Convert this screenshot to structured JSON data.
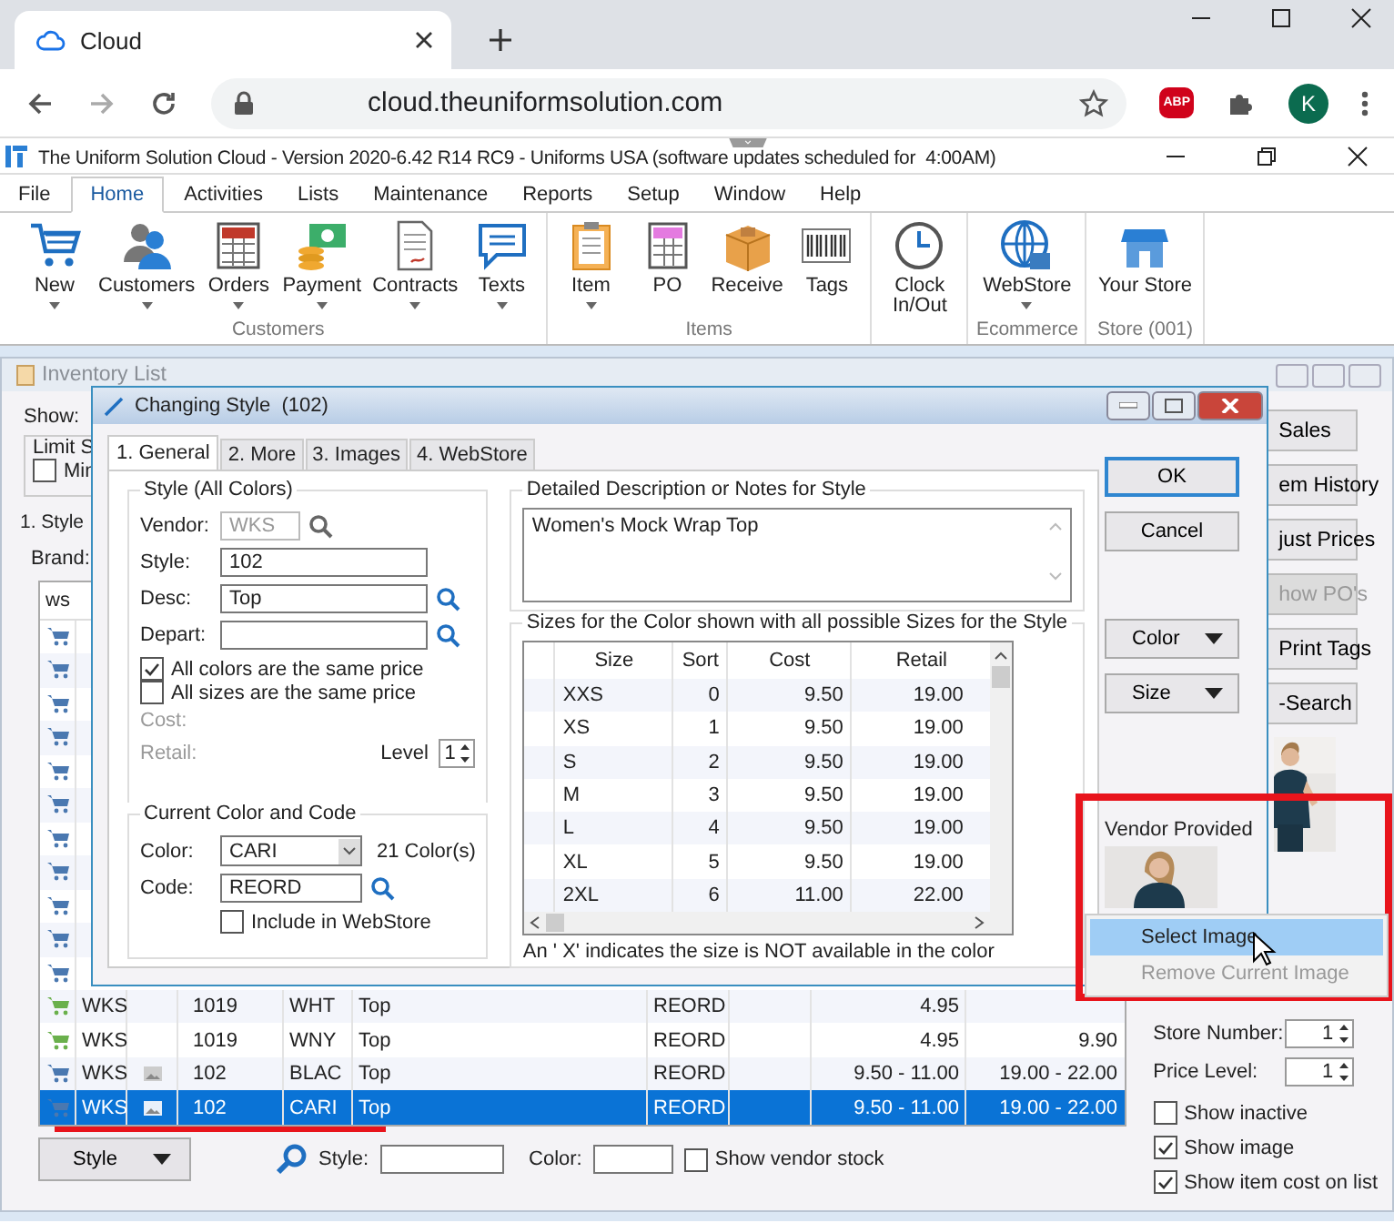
{
  "browser": {
    "tab_title": "Cloud",
    "url": "cloud.theuniformsolution.com",
    "abp": "ABP",
    "avatar": "K"
  },
  "app": {
    "title": "The Uniform Solution Cloud - Version 2020-6.42 R14 RC9 - Uniforms USA (software updates scheduled for  4:00AM)"
  },
  "menu": [
    {
      "label": "File",
      "selected": false
    },
    {
      "label": "Home",
      "selected": true
    },
    {
      "label": "Activities",
      "selected": false
    },
    {
      "label": "Lists",
      "selected": false
    },
    {
      "label": "Maintenance",
      "selected": false
    },
    {
      "label": "Reports",
      "selected": false
    },
    {
      "label": "Setup",
      "selected": false
    },
    {
      "label": "Window",
      "selected": false
    },
    {
      "label": "Help",
      "selected": false
    }
  ],
  "ribbon": [
    {
      "label": "Customers",
      "items": [
        {
          "label": "New",
          "dropdown": true
        },
        {
          "label": "Customers",
          "dropdown": true
        },
        {
          "label": "Orders",
          "dropdown": true
        },
        {
          "label": "Payment",
          "dropdown": true
        },
        {
          "label": "Contracts",
          "dropdown": true
        },
        {
          "label": "Texts",
          "dropdown": true
        }
      ]
    },
    {
      "label": "Items",
      "items": [
        {
          "label": "Item",
          "dropdown": true
        },
        {
          "label": "PO",
          "dropdown": false
        },
        {
          "label": "Receive",
          "dropdown": false
        },
        {
          "label": "Tags",
          "dropdown": false
        }
      ]
    },
    {
      "items": [
        {
          "label": "Clock In/Out",
          "dropdown": false
        }
      ]
    },
    {
      "label": "Ecommerce",
      "items": [
        {
          "label": "WebStore",
          "dropdown": true
        }
      ]
    },
    {
      "label": "Store (001)",
      "items": [
        {
          "label": "Your Store",
          "dropdown": false
        }
      ]
    }
  ],
  "inventory": {
    "title": "Inventory List",
    "show_label": "Show:",
    "limit_label": "Limit S",
    "min_checkbox": {
      "label": "Min",
      "checked": false
    },
    "tab": "1. Style",
    "brand_label": "Brand:",
    "header": "ws",
    "rows": [
      {
        "color": "#4a78b0",
        "selected": false
      },
      {
        "color": "#4a78b0",
        "selected": false
      },
      {
        "color": "#4a78b0",
        "selected": false
      },
      {
        "color": "#4a78b0",
        "selected": false
      },
      {
        "color": "#4a78b0",
        "selected": false
      },
      {
        "color": "#4a78b0",
        "selected": false
      },
      {
        "color": "#4a78b0",
        "selected": false
      },
      {
        "color": "#4a78b0",
        "selected": false
      },
      {
        "color": "#4a78b0",
        "selected": false
      },
      {
        "color": "#4a78b0",
        "selected": false
      },
      {
        "color": "#4a78b0",
        "selected": false
      },
      {
        "color": "#6ab04c",
        "vendor": "WKS",
        "image": false,
        "style": "1019",
        "color_code": "WHT",
        "desc": "Top",
        "code": "REORD",
        "cost": "4.95",
        "selected": false
      },
      {
        "color": "#6ab04c",
        "vendor": "WKS",
        "image": false,
        "style": "1019",
        "color_code": "WNY",
        "desc": "Top",
        "code": "REORD",
        "cost": "4.95",
        "retail": "9.90",
        "selected": false
      },
      {
        "color": "#4a78b0",
        "vendor": "WKS",
        "image": true,
        "style": "102",
        "color_code": "BLAC",
        "desc": "Top",
        "code": "REORD",
        "cost": "9.50 - 11.00",
        "retail": "19.00 - 22.00",
        "selected": false
      },
      {
        "color": "#4a78b0",
        "vendor": "WKS",
        "image": true,
        "style": "102",
        "color_code": "CARI",
        "desc": "Top",
        "code": "REORD",
        "cost": "9.50 - 11.00",
        "retail": "19.00 - 22.00",
        "selected": true
      }
    ],
    "side_buttons": [
      {
        "label": "Sales",
        "disabled": false
      },
      {
        "label": "em History",
        "disabled": false
      },
      {
        "label": "just Prices",
        "disabled": false
      },
      {
        "label": "how PO's",
        "disabled": true
      },
      {
        "label": "Print Tags",
        "disabled": false
      },
      {
        "label": "-Search",
        "disabled": false
      }
    ],
    "store_number": {
      "label": "Store Number:",
      "value": "1"
    },
    "price_level": {
      "label": "Price Level:",
      "value": "1"
    },
    "checkboxes": [
      {
        "label": "Show inactive",
        "checked": false
      },
      {
        "label": "Show image",
        "checked": true
      },
      {
        "label": "Show item cost on list",
        "checked": true
      }
    ],
    "style_button": "Style",
    "style_field_label": "Style:",
    "color_field_label": "Color:",
    "vendor_stock": {
      "label": "Show vendor stock",
      "checked": false
    }
  },
  "dialog": {
    "title": "Changing Style  (102)",
    "tabs": [
      {
        "label": "1. General",
        "selected": true
      },
      {
        "label": "2. More",
        "selected": false
      },
      {
        "label": "3. Images",
        "selected": false
      },
      {
        "label": "4. WebStore",
        "selected": false
      }
    ],
    "style_group": "Style (All Colors)",
    "vendor": {
      "label": "Vendor:",
      "value": "WKS"
    },
    "style": {
      "label": "Style:",
      "value": "102"
    },
    "desc": {
      "label": "Desc:",
      "value": "Top"
    },
    "depart": {
      "label": "Depart:"
    },
    "same_color_price": {
      "label": "All colors are the same price",
      "checked": true
    },
    "same_size_price": {
      "label": "All sizes are the same price",
      "checked": false
    },
    "cost_label": "Cost:",
    "retail_label": "Retail:",
    "level": {
      "label": "Level",
      "value": "1"
    },
    "color_group": "Current Color and Code",
    "color": {
      "label": "Color:",
      "value": "CARI",
      "count": "21 Color(s)"
    },
    "code": {
      "label": "Code:",
      "value": "REORD"
    },
    "include_webstore": {
      "label": "Include in WebStore",
      "checked": false
    },
    "notes_group": "Detailed Description or Notes for Style",
    "notes": "Women's Mock Wrap Top",
    "sizes_group": "Sizes for the Color shown with all possible Sizes for the Style",
    "size_columns": [
      "Size",
      "Sort",
      "Cost",
      "Retail"
    ],
    "sizes": [
      [
        "XXS",
        "0",
        "9.50",
        "19.00"
      ],
      [
        "XS",
        "1",
        "9.50",
        "19.00"
      ],
      [
        "S",
        "2",
        "9.50",
        "19.00"
      ],
      [
        "M",
        "3",
        "9.50",
        "19.00"
      ],
      [
        "L",
        "4",
        "9.50",
        "19.00"
      ],
      [
        "XL",
        "5",
        "9.50",
        "19.00"
      ],
      [
        "2XL",
        "6",
        "11.00",
        "22.00"
      ]
    ],
    "footnote": "An ' X' indicates the size is NOT available in the color",
    "buttons": [
      {
        "label": "OK",
        "default": true
      },
      {
        "label": "Cancel",
        "default": false
      }
    ],
    "menu_buttons": [
      "Color",
      "Size"
    ],
    "vendor_image_label": "Vendor Provided"
  },
  "context_menu": [
    {
      "label": "Select Image",
      "selected": true,
      "disabled": false
    },
    {
      "label": "Remove Current Image",
      "selected": false,
      "disabled": true
    }
  ]
}
